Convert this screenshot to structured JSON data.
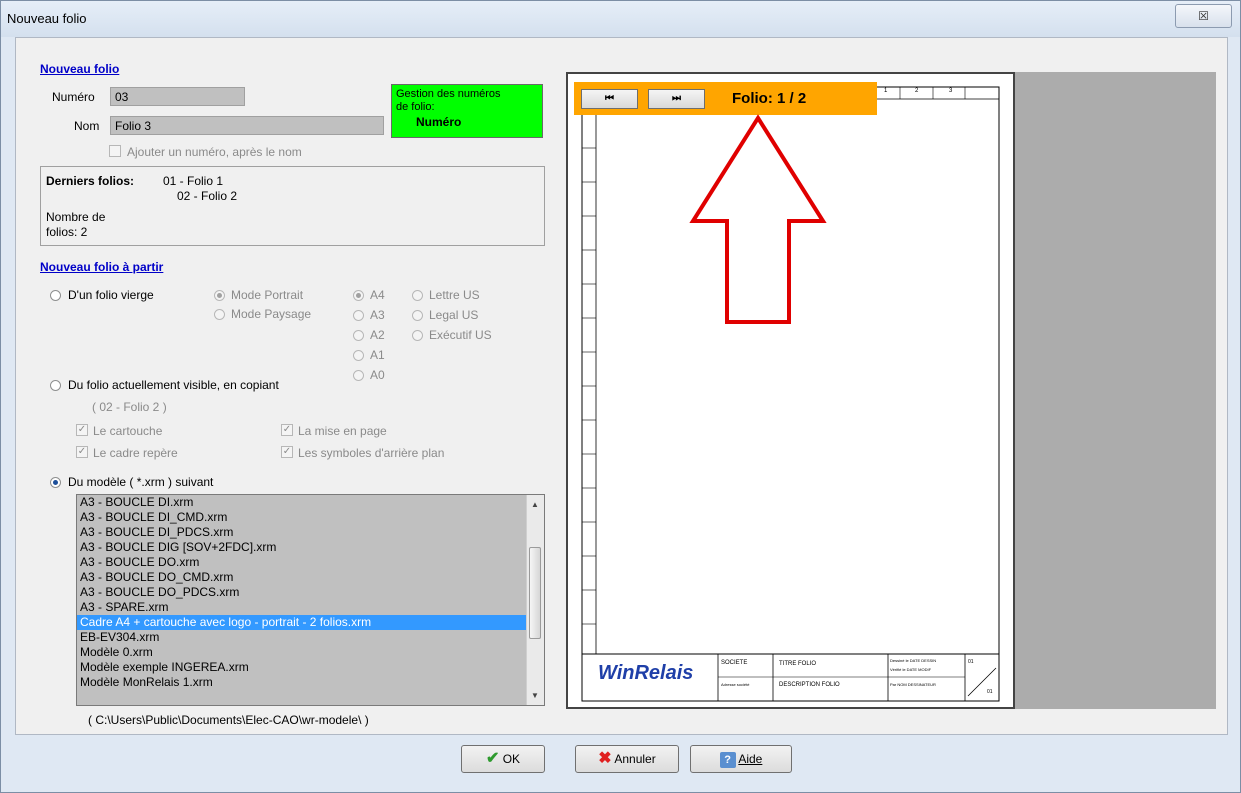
{
  "window": {
    "title": "Nouveau folio",
    "close_label": "☒"
  },
  "nouveau_folio": {
    "title": "Nouveau folio",
    "numero_label": "Numéro",
    "numero_value": "03",
    "nom_label": "Nom",
    "nom_value": "Folio 3",
    "add_number_label": "Ajouter un numéro, après le nom",
    "gestion_line1": "Gestion des numéros",
    "gestion_line2": "de folio:",
    "gestion_value": "Numéro",
    "derniers_label": "Derniers folios:",
    "derniers_items": [
      "01 - Folio 1",
      "02 - Folio 2"
    ],
    "nombre_line1": "Nombre de",
    "nombre_line2": "folios: 2"
  },
  "a_partir": {
    "title": "Nouveau folio à partir",
    "vierge_label": "D'un folio vierge",
    "mode_portrait": "Mode Portrait",
    "mode_paysage": "Mode Paysage",
    "formats": [
      "A4",
      "A3",
      "A2",
      "A1",
      "A0"
    ],
    "us_formats": [
      "Lettre US",
      "Legal US",
      "Exécutif US"
    ],
    "visible_label": "Du folio actuellement visible, en copiant",
    "visible_current": "( 02 - Folio 2 )",
    "copy_cartouche": "Le cartouche",
    "copy_cadre": "Le cadre repère",
    "copy_mise": "La mise en page",
    "copy_symboles": "Les symboles d'arrière plan",
    "modele_label": "Du modèle ( *.xrm ) suivant",
    "models": [
      "A3 - BOUCLE DI.xrm",
      "A3 - BOUCLE DI_CMD.xrm",
      "A3 - BOUCLE DI_PDCS.xrm",
      "A3 - BOUCLE DIG [SOV+2FDC].xrm",
      "A3 - BOUCLE DO.xrm",
      "A3 - BOUCLE DO_CMD.xrm",
      "A3 - BOUCLE DO_PDCS.xrm",
      "A3 - SPARE.xrm",
      "Cadre A4 + cartouche avec logo - portrait - 2 folios.xrm",
      "EB-EV304.xrm",
      "Modèle 0.xrm",
      "Modèle exemple INGEREA.xrm",
      "Modèle MonRelais 1.xrm"
    ],
    "selected_model": "Cadre A4 + cartouche avec logo - portrait - 2 folios.xrm",
    "path": "( C:\\Users\\Public\\Documents\\Elec-CAO\\wr-modele\\ )"
  },
  "preview": {
    "folio_label": "Folio: 1 / 2",
    "prev_label": "⏮",
    "next_label": "⏭",
    "logo_text": "WinRelais",
    "cart_societe": "SOCIETE",
    "cart_adresse": "Adresse société",
    "cart_titre": "TITRE FOLIO",
    "cart_desc": "DESCRIPTION FOLIO",
    "cart_dessin": "Dessiné le  DATE DESSIN",
    "cart_modif": "Vérifié le  DATE MODIF",
    "cart_par": "Par  NOM DESSINATEUR",
    "cart_num1": "01",
    "cart_num2": "01",
    "top_cols": [
      "1",
      "2",
      "3"
    ]
  },
  "buttons": {
    "ok": "OK",
    "annuler": "Annuler",
    "aide": "Aide"
  },
  "colors": {
    "accent_green": "#00ff00",
    "nav_orange": "#ffa500",
    "arrow_red": "#e00000",
    "section_blue": "#0000c8"
  }
}
